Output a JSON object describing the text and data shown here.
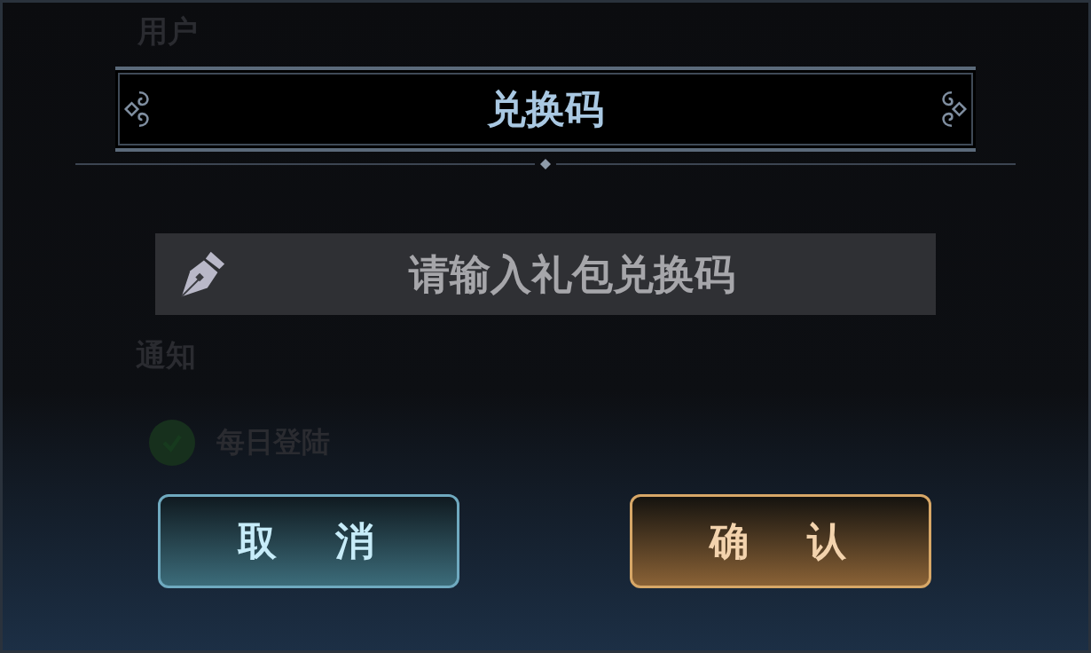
{
  "background": {
    "labels": [
      "用户",
      "通知"
    ],
    "options": [
      {
        "label": "每日登陆",
        "checked": true
      }
    ]
  },
  "dialog": {
    "title": "兑换码",
    "code_field": {
      "placeholder": "请输入礼包兑换码"
    },
    "buttons": [
      {
        "label": "取消",
        "kind": "cancel"
      },
      {
        "label": "确认",
        "kind": "confirm"
      }
    ]
  }
}
